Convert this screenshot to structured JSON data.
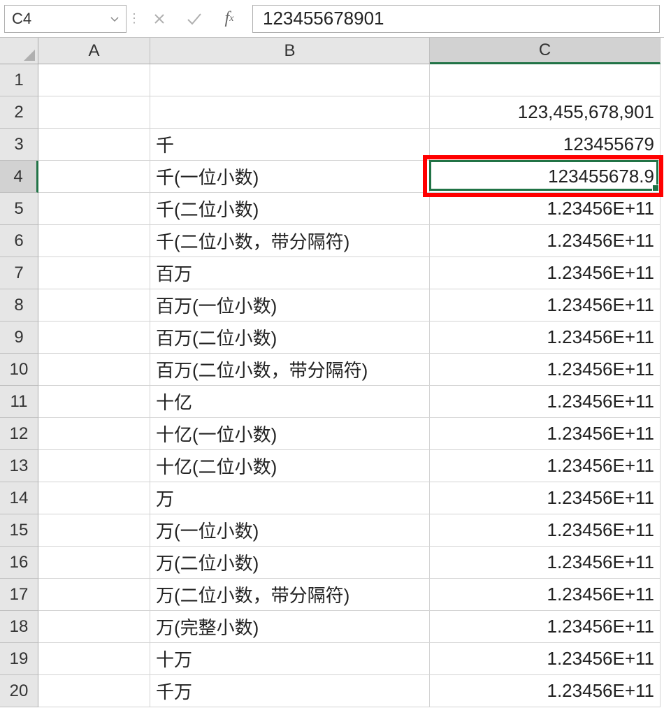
{
  "formula_bar": {
    "name_box": "C4",
    "formula_value": "123455678901"
  },
  "columns": [
    "A",
    "B",
    "C"
  ],
  "selected_column": "C",
  "selected_row": 4,
  "highlight_cell": {
    "col": "C",
    "row": 4
  },
  "rows": [
    {
      "n": 1,
      "B": "",
      "C": ""
    },
    {
      "n": 2,
      "B": "",
      "C": "123,455,678,901"
    },
    {
      "n": 3,
      "B": "千",
      "C": "123455679"
    },
    {
      "n": 4,
      "B": "千(一位小数)",
      "C": "123455678.9"
    },
    {
      "n": 5,
      "B": "千(二位小数)",
      "C": "1.23456E+11"
    },
    {
      "n": 6,
      "B": "千(二位小数，带分隔符)",
      "C": "1.23456E+11"
    },
    {
      "n": 7,
      "B": "百万",
      "C": "1.23456E+11"
    },
    {
      "n": 8,
      "B": "百万(一位小数)",
      "C": "1.23456E+11"
    },
    {
      "n": 9,
      "B": "百万(二位小数)",
      "C": "1.23456E+11"
    },
    {
      "n": 10,
      "B": "百万(二位小数，带分隔符)",
      "C": "1.23456E+11"
    },
    {
      "n": 11,
      "B": "十亿",
      "C": "1.23456E+11"
    },
    {
      "n": 12,
      "B": "十亿(一位小数)",
      "C": "1.23456E+11"
    },
    {
      "n": 13,
      "B": "十亿(二位小数)",
      "C": "1.23456E+11"
    },
    {
      "n": 14,
      "B": "万",
      "C": "1.23456E+11"
    },
    {
      "n": 15,
      "B": "万(一位小数)",
      "C": "1.23456E+11"
    },
    {
      "n": 16,
      "B": "万(二位小数)",
      "C": "1.23456E+11"
    },
    {
      "n": 17,
      "B": "万(二位小数，带分隔符)",
      "C": "1.23456E+11"
    },
    {
      "n": 18,
      "B": "万(完整小数)",
      "C": "1.23456E+11"
    },
    {
      "n": 19,
      "B": "十万",
      "C": "1.23456E+11"
    },
    {
      "n": 20,
      "B": "千万",
      "C": "1.23456E+11"
    }
  ]
}
